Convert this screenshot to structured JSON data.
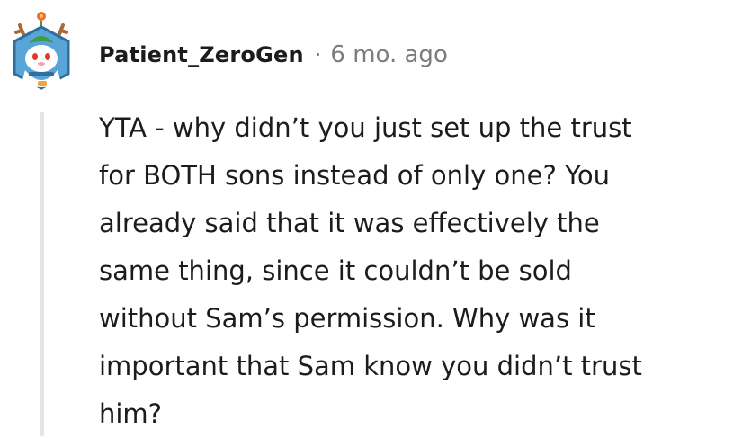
{
  "comment": {
    "username": "Patient_ZeroGen",
    "separator": "·",
    "timestamp": "6 mo. ago",
    "body_lines": [
      "YTA - why didn’t you just set up the trust",
      "for BOTH sons instead of only one? You",
      "already said that it was effectively the",
      "same thing, since it couldn’t be sold",
      "without Sam’s permission. Why was it",
      "important that Sam know you didn’t trust",
      "him?"
    ],
    "avatar_icon": "snoo-reindeer-avatar-icon"
  },
  "colors": {
    "text": "#1c1c1c",
    "muted": "#7c7c7c",
    "thread_line": "#e4e4e4",
    "avatar_bg": "#5aa5d8",
    "avatar_frame": "#2e6f9e"
  }
}
